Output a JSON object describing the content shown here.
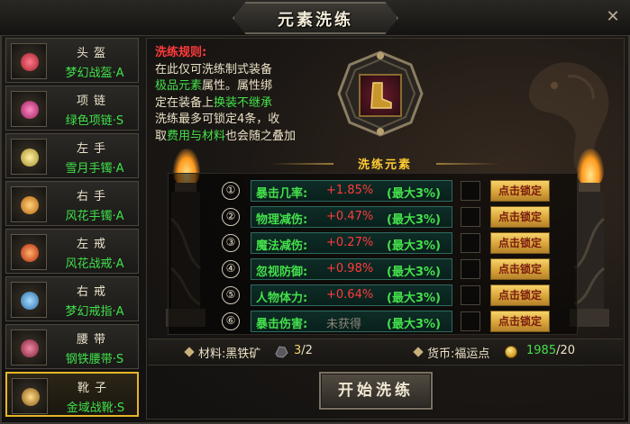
{
  "window": {
    "title": "元素洗练",
    "close_label": "✕"
  },
  "equipment": [
    {
      "slot": "头盔",
      "name": "梦幻战盔·A",
      "icon": "helmet-icon",
      "color": "#e43b4a"
    },
    {
      "slot": "项链",
      "name": "绿色项链·S",
      "icon": "necklace-icon",
      "color": "#d83a8a"
    },
    {
      "slot": "左手",
      "name": "雪月手镯·A",
      "icon": "bracelet-icon",
      "color": "#e6d16a"
    },
    {
      "slot": "右手",
      "name": "风花手镯·A",
      "icon": "bracelet-icon",
      "color": "#f2a52a"
    },
    {
      "slot": "左戒",
      "name": "风花战戒·A",
      "icon": "ring-icon",
      "color": "#e34524"
    },
    {
      "slot": "右戒",
      "name": "梦幻戒指·A",
      "icon": "ring-icon",
      "color": "#4aa7e0"
    },
    {
      "slot": "腰带",
      "name": "钢铁腰带·S",
      "icon": "belt-icon",
      "color": "#b83e5a"
    },
    {
      "slot": "靴子",
      "name": "金域战靴·S",
      "icon": "boots-icon",
      "color": "#d9a13a"
    }
  ],
  "rules": {
    "title": "洗练规则:",
    "line1": "在此仅可洗练制式装备",
    "line2a": "极品元素",
    "line2b": "属性。属性绑",
    "line3a": "定在装备上",
    "line3b": "换装不继承",
    "line4": "洗练最多可锁定4条，收",
    "line5a": "取",
    "line5b": "费用与材料",
    "line5c": "也会随之叠加"
  },
  "section_title": "洗练元素",
  "stats": [
    {
      "index": "①",
      "name": "暴击几率:",
      "value": "+1.85%",
      "max": "(最大3%)",
      "lock": "点击锁定",
      "obtained": true
    },
    {
      "index": "②",
      "name": "物理减伤:",
      "value": "+0.47%",
      "max": "(最大3%)",
      "lock": "点击锁定",
      "obtained": true
    },
    {
      "index": "③",
      "name": "魔法减伤:",
      "value": "+0.27%",
      "max": "(最大3%)",
      "lock": "点击锁定",
      "obtained": true
    },
    {
      "index": "④",
      "name": "忽视防御:",
      "value": "+0.98%",
      "max": "(最大3%)",
      "lock": "点击锁定",
      "obtained": true
    },
    {
      "index": "⑤",
      "name": "人物体力:",
      "value": "+0.64%",
      "max": "(最大3%)",
      "lock": "点击锁定",
      "obtained": true
    },
    {
      "index": "⑥",
      "name": "暴击伤害:",
      "value": "未获得",
      "max": "(最大3%)",
      "lock": "点击锁定",
      "obtained": false
    }
  ],
  "footer": {
    "material_label": "材料:黑铁矿",
    "material_have": "3",
    "material_need": "/2",
    "currency_label": "货币:福运点",
    "currency_have": "1985",
    "currency_need": "/20"
  },
  "start_button": "开始洗练",
  "colors": {
    "accent_gold": "#e8b527",
    "green": "#44e04b",
    "red": "#ff3b3b"
  }
}
